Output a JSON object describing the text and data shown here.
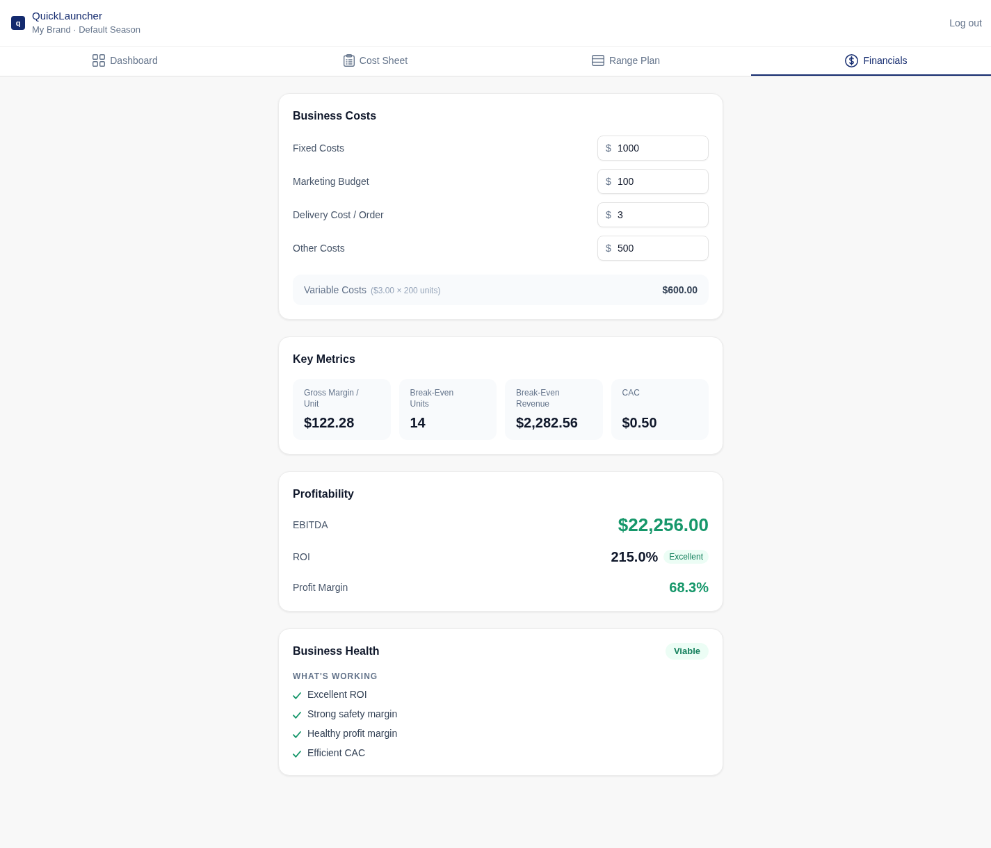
{
  "header": {
    "logo_letter": "q",
    "app_name": "QuickLauncher",
    "subtitle": "My Brand · Default Season",
    "logout": "Log out"
  },
  "tabs": [
    {
      "label": "Dashboard",
      "selected": false
    },
    {
      "label": "Cost Sheet",
      "selected": false
    },
    {
      "label": "Range Plan",
      "selected": false
    },
    {
      "label": "Financials",
      "selected": true
    }
  ],
  "business_costs": {
    "title": "Business Costs",
    "fields": [
      {
        "label": "Fixed Costs",
        "prefix": "$",
        "value": "1000"
      },
      {
        "label": "Marketing Budget",
        "prefix": "$",
        "value": "100"
      },
      {
        "label": "Delivery Cost / Order",
        "prefix": "$",
        "value": "3"
      },
      {
        "label": "Other Costs",
        "prefix": "$",
        "value": "500"
      }
    ],
    "variable_costs": {
      "label": "Variable Costs",
      "detail": "($3.00 × 200 units)",
      "value": "$600.00"
    }
  },
  "key_metrics": {
    "title": "Key Metrics",
    "metrics": [
      {
        "label": "Gross Margin / Unit",
        "value": "$122.28"
      },
      {
        "label": "Break-Even Units",
        "value": "14"
      },
      {
        "label": "Break-Even Revenue",
        "value": "$2,282.56"
      },
      {
        "label": "CAC",
        "value": "$0.50"
      }
    ]
  },
  "profitability": {
    "title": "Profitability",
    "rows": [
      {
        "label": "EBITDA",
        "value": "$22,256.00",
        "kind": "hero"
      },
      {
        "label": "ROI",
        "value": "215.0%",
        "kind": "plain",
        "badge": "Excellent"
      },
      {
        "label": "Profit Margin",
        "value": "68.3%",
        "kind": "positive"
      }
    ]
  },
  "business_health": {
    "title": "Business Health",
    "status": "Viable",
    "section": "WHAT'S WORKING",
    "items": [
      "Excellent ROI",
      "Strong safety margin",
      "Healthy profit margin",
      "Efficient CAC"
    ]
  }
}
